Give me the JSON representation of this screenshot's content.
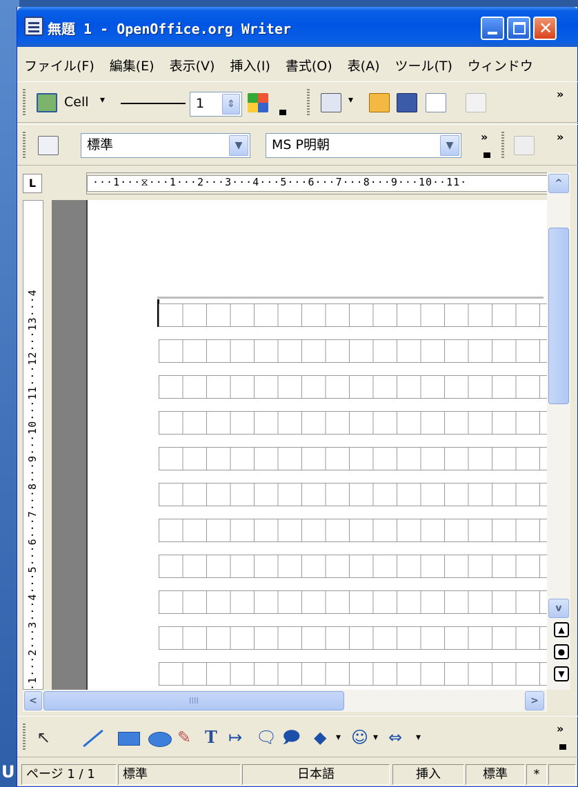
{
  "window": {
    "title": "無題 1 - OpenOffice.org Writer",
    "close_glyph": "✕"
  },
  "desktop": {
    "label": "U"
  },
  "menu": {
    "items": [
      "ファイル(F)",
      "編集(E)",
      "表示(V)",
      "挿入(I)",
      "書式(O)",
      "表(A)",
      "ツール(T)",
      "ウィンドウ"
    ]
  },
  "table_toolbar": {
    "cell_label": "Cell",
    "line_width_value": "1",
    "more_glyph": "»"
  },
  "format_toolbar": {
    "paragraph_style": "標準",
    "font_name": "MS P明朝",
    "more_glyph": "»"
  },
  "ruler": {
    "corner": "L",
    "horizontal": "···1···⧖···1···2···3···4···5···6···7···8···9···10··11·",
    "vertical": "··1···2···3···4···5···6···7···8···9···10···11···12···13···4"
  },
  "scrollbar": {
    "up": "^",
    "down": "v",
    "left": "<",
    "right": ">",
    "hthumb_grip": "IIII",
    "nav_prev": "▲",
    "nav_mid": "●",
    "nav_next": "▼"
  },
  "status": {
    "page": "ページ 1 / 1",
    "page_style": "標準",
    "language": "日本語",
    "insert_mode": "挿入",
    "selection_mode": "標準",
    "modified": "*"
  },
  "colors": {
    "titlebar": "#0054e3",
    "window_bg": "#ece9d8",
    "doc_gray": "#808080"
  }
}
